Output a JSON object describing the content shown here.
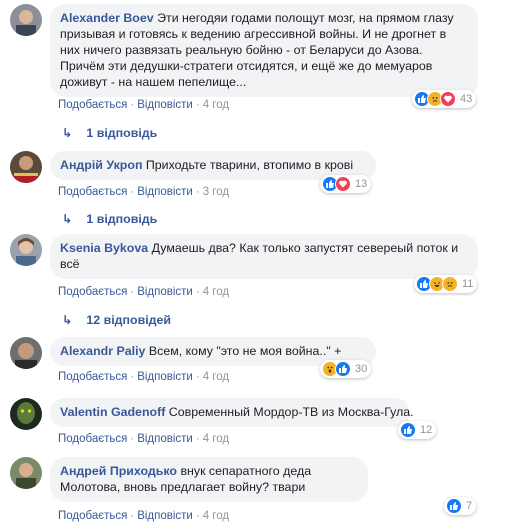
{
  "comments": [
    {
      "author": "Alexander Boev",
      "text": "Эти негодяи годами полощут мозг, на прямом глазу призывая и готовясь к ведению агрессивной войны. И не дрогнет в них ничего развязать реальную бойню - от Беларуси до Азова. Причём эти дедушки-стратеги отсидятся, и ещё же до мемуаров доживут - на нашем пепелище...",
      "like_label": "Подобається",
      "reply_label": "Відповісти",
      "time": "4 год",
      "reaction_icons": [
        "like",
        "sad",
        "love"
      ],
      "reaction_count": "43",
      "replies": "1 відповідь"
    },
    {
      "author": "Андрій Укроп",
      "text": "Приходьте тварини, втопимо в крові",
      "like_label": "Подобається",
      "reply_label": "Відповісти",
      "time": "3 год",
      "reaction_icons": [
        "like",
        "love"
      ],
      "reaction_count": "13",
      "replies": "1 відповідь"
    },
    {
      "author": "Ksenia Bykova",
      "text": "Думаешь два? Как только запустят севереый поток и всё",
      "like_label": "Подобається",
      "reply_label": "Відповісти",
      "time": "4 год",
      "reaction_icons": [
        "like",
        "haha",
        "sad"
      ],
      "reaction_count": "11",
      "replies": "12 відповідей"
    },
    {
      "author": "Alexandr Paliy",
      "text": "Всем, кому \"это не моя война..\" +",
      "like_label": "Подобається",
      "reply_label": "Відповісти",
      "time": "4 год",
      "reaction_icons": [
        "wow",
        "like"
      ],
      "reaction_count": "30"
    },
    {
      "author": "Valentin Gadenoff",
      "text": "Современный Мордор-ТВ из Москва-Гула.",
      "like_label": "Подобається",
      "reply_label": "Відповісти",
      "time": "4 год",
      "reaction_icons": [
        "like"
      ],
      "reaction_count": "12"
    },
    {
      "author": "Андрей Приходько",
      "text": "внук сепаратного деда Молотова, вновь предлагает войну? твари",
      "like_label": "Подобається",
      "reply_label": "Відповісти",
      "time": "4 год",
      "reaction_icons": [
        "like"
      ],
      "reaction_count": "7"
    }
  ],
  "colors": {
    "link": "#385898",
    "bubble": "#f2f3f5",
    "muted": "#90949c",
    "like": "#1877f2",
    "love": "#f33e58",
    "emoji": "#f7b125"
  }
}
